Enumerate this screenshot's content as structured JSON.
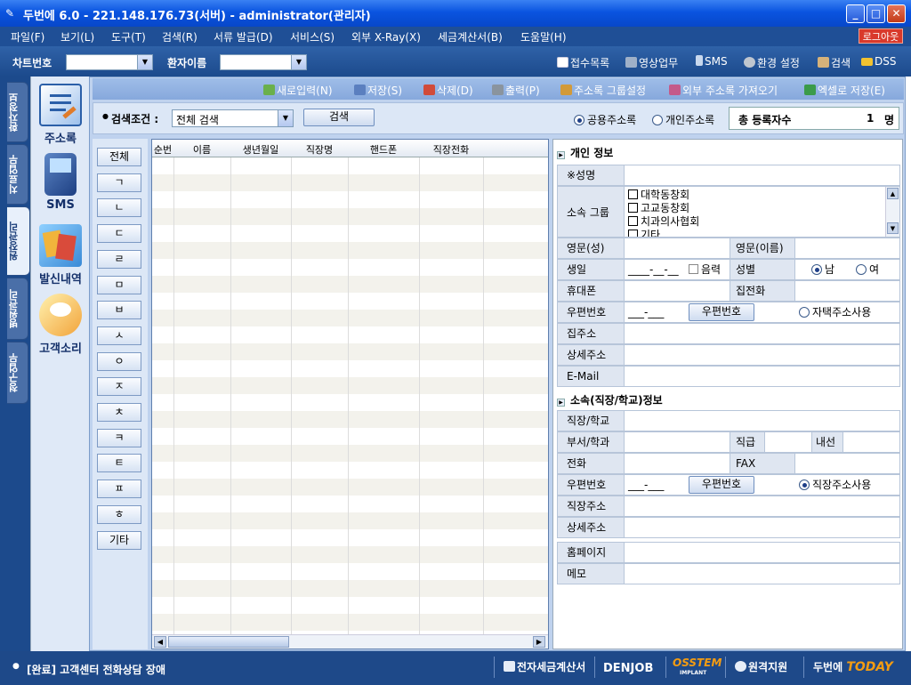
{
  "window": {
    "title": "두번에 6.0 - 221.148.176.73(서버) - administrator(관리자)"
  },
  "menu": {
    "items": [
      "파일(F)",
      "보기(L)",
      "도구(T)",
      "검색(R)",
      "서류 발급(D)",
      "서비스(S)",
      "외부 X-Ray(X)",
      "세금계산서(B)",
      "도움말(H)"
    ],
    "logout": "로그아웃"
  },
  "toolbar": {
    "chart_no_label": "차트번호",
    "patient_name_label": "환자이름",
    "chart_no_value": "",
    "patient_name_value": "",
    "buttons": [
      "접수목록",
      "영상업무",
      "SMS",
      "환경 설정",
      "검색",
      "DSS"
    ]
  },
  "left_tabs": [
    "환자정보",
    "치료업무",
    "원장관리",
    "병원관리",
    "청구업무"
  ],
  "sidebar": {
    "items": [
      "주소록",
      "SMS",
      "발신내역",
      "고객소리"
    ]
  },
  "address_toolbar": {
    "buttons": [
      "새로입력(N)",
      "저장(S)",
      "삭제(D)",
      "출력(P)",
      "주소록 그룹설정",
      "외부 주소록 가져오기",
      "엑셀로 저장(E)"
    ]
  },
  "search": {
    "label": "검색조건 :",
    "value": "전체 검색",
    "button": "검색",
    "radio_public": "공용주소록",
    "radio_private": "개인주소록",
    "selected": "public",
    "total_label": "총 등록자수",
    "total_count": "1",
    "total_unit": "명"
  },
  "alphabet": [
    "전체",
    "ㄱ",
    "ㄴ",
    "ㄷ",
    "ㄹ",
    "ㅁ",
    "ㅂ",
    "ㅅ",
    "ㅇ",
    "ㅈ",
    "ㅊ",
    "ㅋ",
    "ㅌ",
    "ㅍ",
    "ㅎ",
    "기타"
  ],
  "grid": {
    "columns": [
      "순번",
      "이름",
      "생년월일",
      "직장명",
      "핸드폰",
      "직장전화"
    ],
    "rows": []
  },
  "personal": {
    "section": "개인 정보",
    "name_label": "※성명",
    "group_label": "소속 그룹",
    "groups": [
      "대학동창회",
      "고교동창회",
      "치과의사협회",
      "기타"
    ],
    "eng_last_label": "영문(성)",
    "eng_first_label": "영문(이름)",
    "birth_label": "생일",
    "birth_value": "____-__-__",
    "lunar_label": "음력",
    "gender_label": "성별",
    "male": "남",
    "female": "여",
    "gender_selected": "male",
    "mobile_label": "휴대폰",
    "homephone_label": "집전화",
    "zip_label": "우편번호",
    "zip_value": "___-___",
    "zip_button": "우편번호",
    "home_addr_use": "자택주소사용",
    "home_addr_label": "집주소",
    "detail_addr_label": "상세주소",
    "email_label": "E-Mail"
  },
  "work": {
    "section": "소속(직장/학교)정보",
    "company_label": "직장/학교",
    "dept_label": "부서/학과",
    "position_label": "직급",
    "ext_label": "내선",
    "phone_label": "전화",
    "fax_label": "FAX",
    "zip_label": "우편번호",
    "zip_value": "___-___",
    "zip_button": "우편번호",
    "work_addr_use": "직장주소사용",
    "work_addr_label": "직장주소",
    "detail_addr_label": "상세주소",
    "homepage_label": "홈페이지",
    "memo_label": "메모"
  },
  "status": {
    "message": "[완료] 고객센터 전화상담 장애",
    "tax": "전자세금계산서",
    "denjob": "DENJOB",
    "osstem": "OSSTEM",
    "osstem_sub": "IMPLANT",
    "remote": "원격지원",
    "brand_a": "두번에",
    "brand_b": "TODAY"
  },
  "colors": {
    "title_bar": "#0a54e0",
    "menu_bar": "#1f4f96",
    "accent_orange": "#f39c12",
    "logout": "#d9392b"
  }
}
